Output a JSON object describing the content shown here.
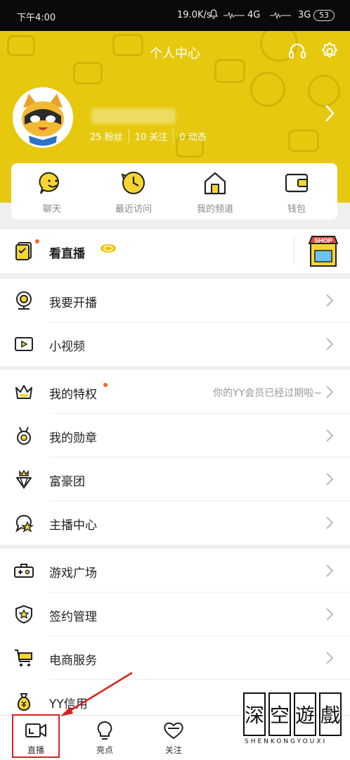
{
  "status_bar": {
    "time": "下午4:00",
    "speed": "19.0K/s",
    "net1": "4G",
    "net2": "3G",
    "battery": "53"
  },
  "header": {
    "title": "个人中心",
    "stats": {
      "fans": "25 粉丝",
      "follows": "10 关注",
      "posts": "0 动态"
    }
  },
  "quick_actions": [
    {
      "label": "聊天",
      "icon": "chat-icon"
    },
    {
      "label": "最近访问",
      "icon": "clock-icon"
    },
    {
      "label": "我的频道",
      "icon": "home-icon"
    },
    {
      "label": "钱包",
      "icon": "wallet-icon"
    }
  ],
  "live_watch": {
    "label": "看直播",
    "shop_label": "SHOP"
  },
  "section1": [
    {
      "label": "我要开播",
      "icon": "webcam-icon"
    },
    {
      "label": "小视频",
      "icon": "video-play-icon"
    }
  ],
  "section2": [
    {
      "label": "我的特权",
      "icon": "crown-icon",
      "sub": "你的YY会员已经过期啦~"
    },
    {
      "label": "我的勋章",
      "icon": "medal-icon"
    },
    {
      "label": "富豪团",
      "icon": "diamond-crown-icon"
    },
    {
      "label": "主播中心",
      "icon": "star-chat-icon"
    }
  ],
  "section3": [
    {
      "label": "游戏广场",
      "icon": "gamepad-icon"
    },
    {
      "label": "签约管理",
      "icon": "badge-star-icon"
    },
    {
      "label": "电商服务",
      "icon": "cart-icon"
    },
    {
      "label": "YY信用",
      "icon": "money-bag-icon"
    }
  ],
  "bottom_nav": [
    {
      "label": "直播",
      "icon": "live-camera-icon"
    },
    {
      "label": "亮点",
      "icon": "bulb-icon"
    },
    {
      "label": "关注",
      "icon": "heart-icon"
    }
  ],
  "watermark": {
    "chars": [
      "深",
      "空",
      "遊",
      "戲"
    ],
    "caption": "SHENKONGYOUXI"
  },
  "colors": {
    "accent": "#e6c90f",
    "highlight": "#d62222",
    "dot": "#f2662f"
  }
}
